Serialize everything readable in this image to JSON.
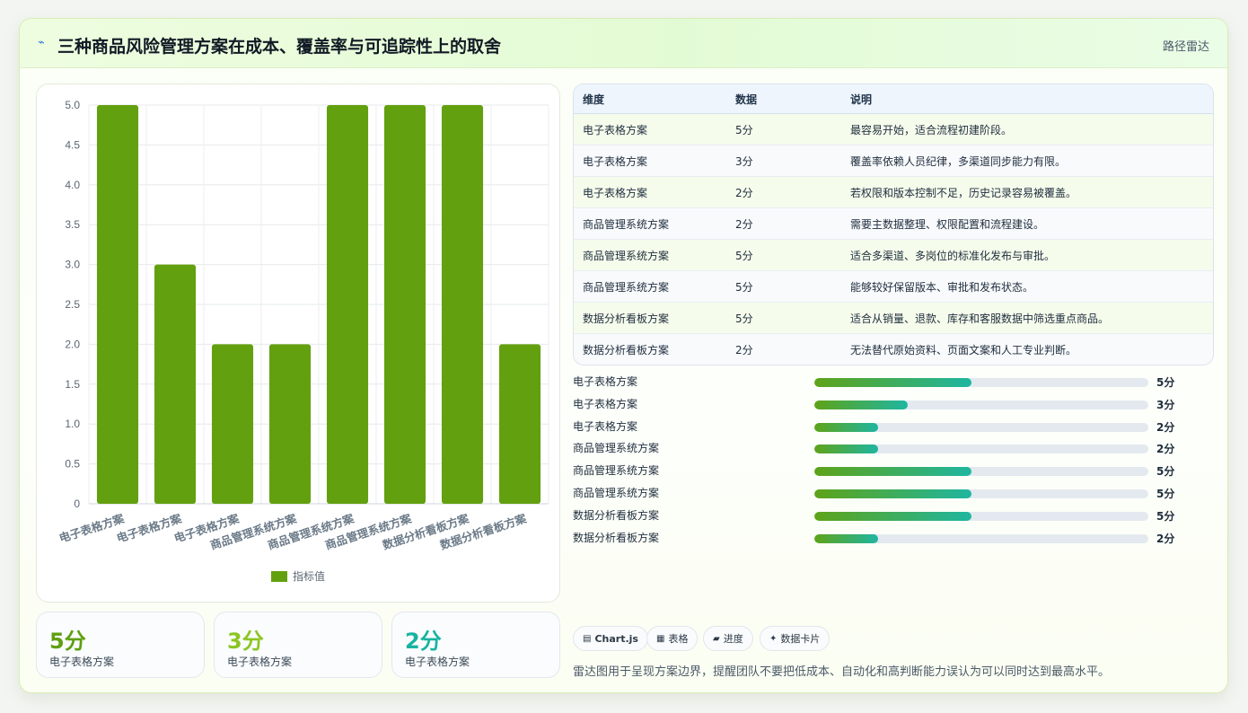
{
  "header": {
    "icon": "lightning-icon",
    "title": "三种商品风险管理方案在成本、覆盖率与可追踪性上的取舍",
    "tag": "路径雷达"
  },
  "chart_data": {
    "type": "bar",
    "categories": [
      "电子表格方案",
      "电子表格方案",
      "电子表格方案",
      "商品管理系统方案",
      "商品管理系统方案",
      "商品管理系统方案",
      "数据分析看板方案",
      "数据分析看板方案"
    ],
    "series": [
      {
        "name": "指标值",
        "values": [
          5,
          3,
          2,
          2,
          5,
          5,
          5,
          2
        ],
        "color": "#63a00f"
      }
    ],
    "y_ticks": [
      "5.0",
      "4.5",
      "4.0",
      "3.5",
      "3.0",
      "2.5",
      "2.0",
      "1.5",
      "1.0",
      "0.5",
      "0"
    ],
    "ylim": [
      0,
      5
    ],
    "grid": true,
    "legend": "bottom"
  },
  "stats": [
    {
      "value": "5分",
      "label": "电子表格方案",
      "color": "#5f9f10"
    },
    {
      "value": "3分",
      "label": "电子表格方案",
      "color": "#8cc523"
    },
    {
      "value": "2分",
      "label": "电子表格方案",
      "color": "#17b3a0"
    }
  ],
  "table": {
    "headers": [
      "维度",
      "数据",
      "说明"
    ],
    "rows": [
      [
        "电子表格方案",
        "5分",
        "最容易开始，适合流程初建阶段。"
      ],
      [
        "电子表格方案",
        "3分",
        "覆盖率依赖人员纪律，多渠道同步能力有限。"
      ],
      [
        "电子表格方案",
        "2分",
        "若权限和版本控制不足，历史记录容易被覆盖。"
      ],
      [
        "商品管理系统方案",
        "2分",
        "需要主数据整理、权限配置和流程建设。"
      ],
      [
        "商品管理系统方案",
        "5分",
        "适合多渠道、多岗位的标准化发布与审批。"
      ],
      [
        "商品管理系统方案",
        "5分",
        "能够较好保留版本、审批和发布状态。"
      ],
      [
        "数据分析看板方案",
        "5分",
        "适合从销量、退款、库存和客服数据中筛选重点商品。"
      ],
      [
        "数据分析看板方案",
        "2分",
        "无法替代原始资料、页面文案和人工专业判断。"
      ]
    ]
  },
  "progress": [
    {
      "label": "电子表格方案",
      "value": "5分",
      "fraction": 0.47
    },
    {
      "label": "电子表格方案",
      "value": "3分",
      "fraction": 0.28
    },
    {
      "label": "电子表格方案",
      "value": "2分",
      "fraction": 0.19
    },
    {
      "label": "商品管理系统方案",
      "value": "2分",
      "fraction": 0.19
    },
    {
      "label": "商品管理系统方案",
      "value": "5分",
      "fraction": 0.47
    },
    {
      "label": "商品管理系统方案",
      "value": "5分",
      "fraction": 0.47
    },
    {
      "label": "数据分析看板方案",
      "value": "5分",
      "fraction": 0.47
    },
    {
      "label": "数据分析看板方案",
      "value": "2分",
      "fraction": 0.19
    }
  ],
  "chips": [
    {
      "icon": "chart-icon",
      "glyph": "▤",
      "label": "Chart.js"
    },
    {
      "icon": "table-icon",
      "glyph": "▦",
      "label": "表格"
    },
    {
      "icon": "progress-icon",
      "glyph": "▰",
      "label": "进度"
    },
    {
      "icon": "sparkle-icon",
      "glyph": "✦",
      "label": "数据卡片"
    }
  ],
  "footnote": "雷达图用于呈现方案边界，提醒团队不要把低成本、自动化和高判断能力误认为可以同时达到最高水平。"
}
